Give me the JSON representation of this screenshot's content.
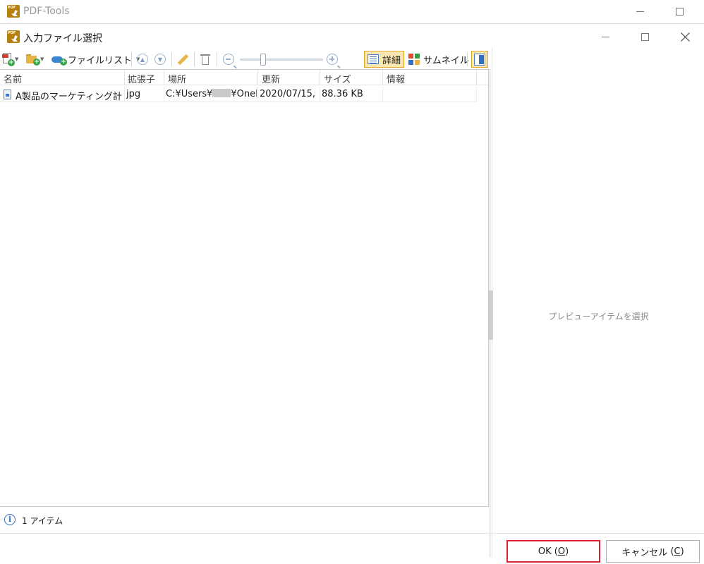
{
  "main_window": {
    "title": "PDF-Tools"
  },
  "dialog": {
    "title": "入力ファイル選択",
    "toolbar": {
      "file_list_label": "ファイルリスト",
      "detail_view_label": "詳細",
      "thumbnail_view_label": "サムネイル"
    },
    "table": {
      "columns": [
        "名前",
        "拡張子",
        "場所",
        "更新",
        "サイズ",
        "情報"
      ],
      "rows": [
        {
          "name": "A製品のマーケティング計画",
          "ext": "jpg",
          "location_prefix": "C:¥Users¥",
          "location_suffix": "¥OneD",
          "modified": "2020/07/15,",
          "size": "88.36 KB",
          "info": ""
        }
      ]
    },
    "preview_placeholder": "プレビューアイテムを選択",
    "status": "1 アイテム",
    "buttons": {
      "ok_label": "OK",
      "ok_accel": "O",
      "cancel_label": "キャンセル",
      "cancel_accel": "C"
    },
    "colors": {
      "highlight_border": "#d9232e",
      "active_view_bg": "#fbe7b1",
      "accent_blue": "#2f6fc4"
    }
  }
}
